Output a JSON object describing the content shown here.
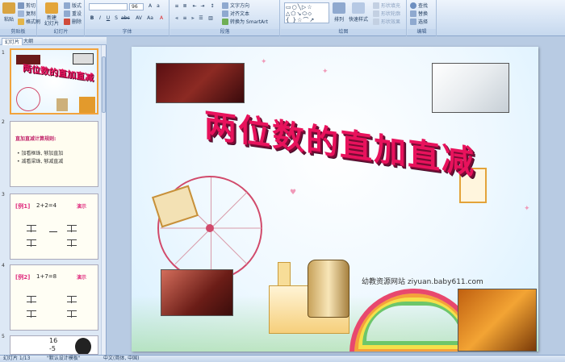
{
  "ribbon": {
    "clipboard": {
      "label": "剪贴板",
      "paste": "粘贴",
      "cut": "剪切",
      "copy": "复制",
      "format_painter": "格式刷"
    },
    "slides": {
      "label": "幻灯片",
      "new_slide": "新建\n幻灯片",
      "layout": "版式",
      "reset": "重设",
      "delete": "删除"
    },
    "font": {
      "label": "字体",
      "font_name": "",
      "font_size": "96"
    },
    "paragraph": {
      "label": "段落",
      "text_direction": "文字方向",
      "align_text": "对齐文本",
      "smartart": "转换为 SmartArt"
    },
    "drawing": {
      "label": "绘图",
      "arrange": "排列",
      "quick_styles": "快速样式",
      "shape_fill": "形状填充",
      "shape_outline": "形状轮廓",
      "shape_effects": "形状效果"
    },
    "editing": {
      "label": "编辑",
      "find": "查找",
      "replace": "替换",
      "select": "选择"
    }
  },
  "pane": {
    "tab_slides": "幻灯片",
    "tab_outline": "大纲",
    "slide_numbers": [
      "1",
      "2",
      "3",
      "4",
      "5"
    ],
    "thumb2": {
      "heading": "直加直减计算规则:",
      "line1": "• 加看框珠, 够加直加",
      "line2": "• 减看梁珠, 够减直减"
    },
    "thumb3": {
      "tag": "[例1]",
      "eq": "2+2=4",
      "note": "演示"
    },
    "thumb4": {
      "tag": "[例2]",
      "eq": "1+7=8",
      "note": "演示"
    },
    "thumb5": {
      "top": "16",
      "bottom": "-5"
    }
  },
  "slide": {
    "title": "两位数的直加直减",
    "watermark": "幼教资源网站  ziyuan.baby611.com"
  },
  "status": {
    "slide_info": "幻灯片 1/13",
    "theme": "\"默认设计模板\"",
    "language": "中文(简体, 中国)"
  },
  "colors": {
    "title": "#e8125c",
    "title_shadow": "#7b0a34",
    "selection": "#f2a33c"
  }
}
